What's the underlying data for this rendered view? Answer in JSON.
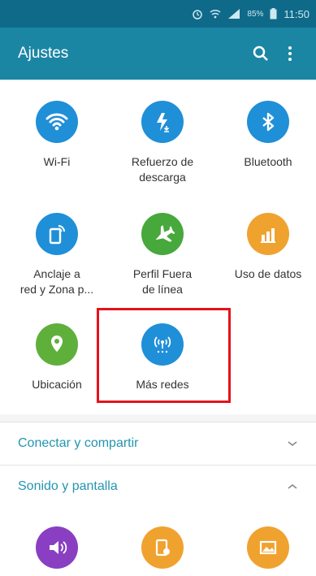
{
  "status_bar": {
    "battery_text": "85%",
    "time": "11:50",
    "icons": [
      "alarm-icon",
      "wifi-icon",
      "signal-icon",
      "battery-icon"
    ]
  },
  "app_bar": {
    "title": "Ajustes",
    "actions": [
      "search-icon",
      "more-vert-icon"
    ]
  },
  "quick_settings": [
    {
      "label": "Wi-Fi",
      "icon": "wifi-icon",
      "color": "#1f8fd8"
    },
    {
      "label": "Refuerzo de\ndescarga",
      "icon": "download-booster-icon",
      "color": "#1f8fd8"
    },
    {
      "label": "Bluetooth",
      "icon": "bluetooth-icon",
      "color": "#1f8fd8"
    },
    {
      "label": "Anclaje a\nred y Zona p...",
      "icon": "tethering-icon",
      "color": "#1f8fd8"
    },
    {
      "label": "Perfil Fuera\nde línea",
      "icon": "airplane-icon",
      "color": "#47a83c"
    },
    {
      "label": "Uso de datos",
      "icon": "data-usage-icon",
      "color": "#f0a22f"
    },
    {
      "label": "Ubicación",
      "icon": "location-icon",
      "color": "#5fb03b"
    },
    {
      "label": "Más redes",
      "icon": "more-networks-icon",
      "color": "#1f8fd8"
    }
  ],
  "sections": [
    {
      "title": "Conectar y compartir",
      "state": "collapsed",
      "icon": "chevron-down-icon"
    },
    {
      "title": "Sonido y pantalla",
      "state": "expanded",
      "icon": "chevron-up-icon"
    }
  ],
  "bottom_icons": [
    {
      "icon": "sound-icon",
      "color": "#8a3fc2"
    },
    {
      "icon": "notification-panel-icon",
      "color": "#f0a22f"
    },
    {
      "icon": "wallpaper-icon",
      "color": "#f0a22f"
    }
  ],
  "highlight_color": "#e4131b",
  "accent_color": "#1b86a4"
}
